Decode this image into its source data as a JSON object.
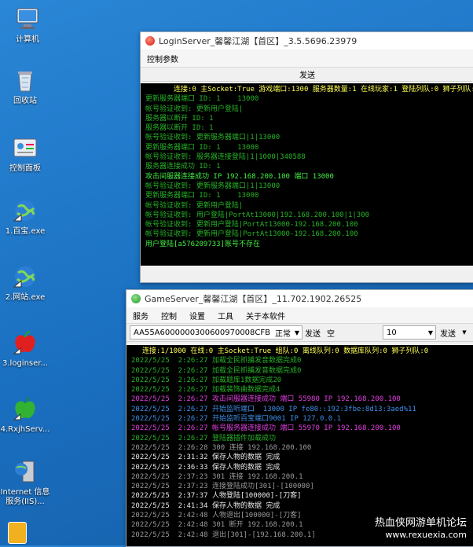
{
  "desktop": {
    "icons": [
      {
        "label": "计算机"
      },
      {
        "label": "回收站"
      },
      {
        "label": "控制面板"
      },
      {
        "label": "1.百宝.exe"
      },
      {
        "label": "2.网站.exe"
      },
      {
        "label": "3.loginser..."
      },
      {
        "label": "4.RxjhServ..."
      },
      {
        "label": "Internet 信息服务(IIS)..."
      }
    ]
  },
  "login_window": {
    "title": "LoginServer_馨馨江湖【首区】_3.5.5696.23979",
    "menu_label": "控制参数",
    "send_button": "发送",
    "status_line": "连接:0 主Socket:True 游戏端口:1300 服务器数量:1 在线玩家:1 登陆列队:0 狮子列队:0",
    "logs": [
      {
        "text": "更新服务器端口 ID: 1    13000",
        "color": "green"
      },
      {
        "text": "帐号验证收到: 更新用户登陆|",
        "color": "green"
      },
      {
        "text": "服务器以断开 ID: 1",
        "color": "green"
      },
      {
        "text": "服务器以断开 ID: 1",
        "color": "green"
      },
      {
        "text": "帐号验证收到: 更新服务器端口|1|13000",
        "color": "green"
      },
      {
        "text": "更新服务器端口 ID: 1    13000",
        "color": "green"
      },
      {
        "text": "帐号验证收到: 服务器连接登陆|1|1000|340588",
        "color": "green"
      },
      {
        "text": "服务器连接成功 ID: 1",
        "color": "green"
      },
      {
        "text": "攻击间服器连接成功 IP 192.168.200.100 端口 13000",
        "color": "bright"
      },
      {
        "text": "帐号验证收到: 更新服务器端口|1|13000",
        "color": "green"
      },
      {
        "text": "更新服务器端口 ID: 1    13000",
        "color": "green"
      },
      {
        "text": "帐号验证收到: 更新用户登陆|",
        "color": "green"
      },
      {
        "text": "帐号验证收到: 用户登陆|PortAt13000|192.168.200.100|1|300",
        "color": "green"
      },
      {
        "text": "帐号验证收到: 更新用户登陆|PortAt13000-192.168.200.100",
        "color": "green"
      },
      {
        "text": "帐号验证收到: 更新用户登陆|PortAt13000-192.168.200.100",
        "color": "green"
      },
      {
        "text": "用户登陆[a576209733]账号不存在",
        "color": "bright"
      }
    ]
  },
  "game_window": {
    "title": "GameServer_馨馨江湖【首区】_11.702.1902.26525",
    "menus": [
      "服务",
      "控制",
      "设置",
      "工具",
      "关于本软件"
    ],
    "hex_value": "AA55A6000000300600970008CFB",
    "mode_value": "正常",
    "send_label_1": "发送",
    "empty_label": "空",
    "count_value": "10",
    "send_label_2": "发送",
    "status_line": "连接:1/1000 在线:0 主Socket:True 组队:0 离线队列:0 数据库队列:0 狮子列队:0",
    "logs": [
      {
        "text": "2022/5/25  2:26:27 加载全民抓捕发音数据完成0",
        "color": "green"
      },
      {
        "text": "2022/5/25  2:26:27 加载全民抓捕发音数据完成0",
        "color": "green"
      },
      {
        "text": "2022/5/25  2:26:27 加载题库1数据完成20",
        "color": "green"
      },
      {
        "text": "2022/5/25  2:26:27 加载装饰曲数据完成4",
        "color": "green"
      },
      {
        "text": "2022/5/25  2:26:27 攻击间服器连接成功 端口 55980 IP 192.168.200.100",
        "color": "magenta"
      },
      {
        "text": "2022/5/25  2:26:27 开始监听端口  13000 IP fe80::192:3fbe:8d13:3aed%11",
        "color": "blue"
      },
      {
        "text": "2022/5/25  2:26:27 开始监听百宝端口9001 IP 127.0.0.1",
        "color": "blue"
      },
      {
        "text": "2022/5/25  2:26:27 帐号服务器连接成功 端口 55970 IP 192.168.200.100",
        "color": "magenta"
      },
      {
        "text": "2022/5/25  2:26:27 登陆器插件加载成功",
        "color": "green"
      },
      {
        "text": "2022/5/25  2:26:28 300 连接 192.168.200.100",
        "color": "gray"
      },
      {
        "text": "2022/5/25  2:31:32 保存人物的数据 完成",
        "color": "white"
      },
      {
        "text": "2022/5/25  2:36:33 保存人物的数据 完成",
        "color": "white"
      },
      {
        "text": "2022/5/25  2:37:23 301 连接 192.168.200.1",
        "color": "gray"
      },
      {
        "text": "2022/5/25  2:37:23 连接登陆成功[301]-[100000]",
        "color": "gray"
      },
      {
        "text": "2022/5/25  2:37:37 人物登陆[100000]-[刀客]",
        "color": "white"
      },
      {
        "text": "2022/5/25  2:41:34 保存人物的数据 完成",
        "color": "white"
      },
      {
        "text": "2022/5/25  2:42:48 人物退出[100000]-[刀客]",
        "color": "gray"
      },
      {
        "text": "2022/5/25  2:42:48 301 断开 192.168.200.1",
        "color": "gray"
      },
      {
        "text": "2022/5/25  2:42:48 退出[301]-[192.168.200.1]",
        "color": "gray"
      }
    ]
  },
  "watermark": {
    "line1": "热血侠网游单机论坛",
    "line2": "www.rexuexia.com"
  }
}
